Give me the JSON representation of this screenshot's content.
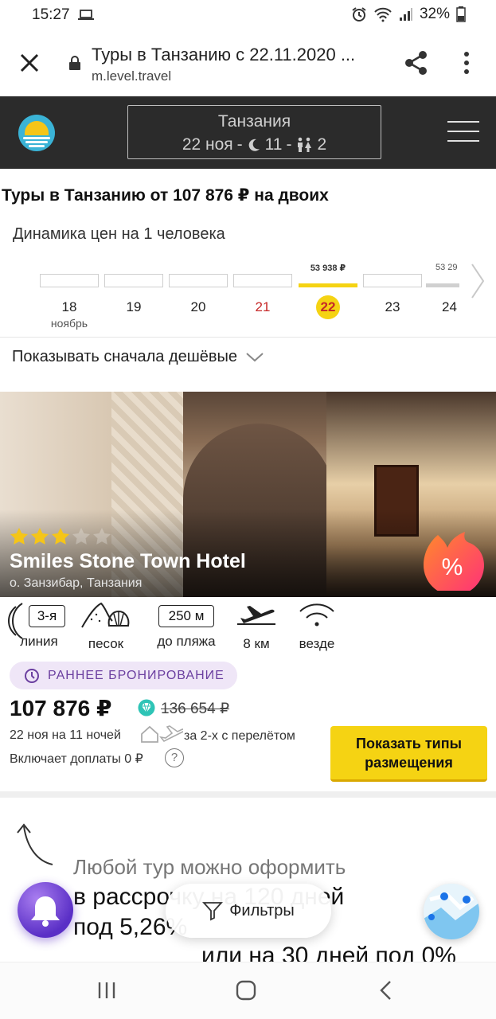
{
  "status_bar": {
    "time": "15:27",
    "battery": "32%"
  },
  "browser": {
    "title": "Туры в Танзанию с 22.11.2020 ...",
    "url": "m.level.travel"
  },
  "header": {
    "destination": "Танзания",
    "date": "22 ноя",
    "nights": "11",
    "tourists": "2",
    "separator": "-"
  },
  "page": {
    "heading": "Туры в Танзанию от 107 876 ₽ на двоих",
    "dynamics_title": "Динамика цен на 1 человека",
    "sort_label": "Показывать сначала дешёвые"
  },
  "calendar": {
    "month": "ноябрь",
    "days": [
      {
        "day": "18",
        "price": "",
        "weekend": false,
        "selected": false
      },
      {
        "day": "19",
        "price": "",
        "weekend": false,
        "selected": false
      },
      {
        "day": "20",
        "price": "",
        "weekend": false,
        "selected": false
      },
      {
        "day": "21",
        "price": "",
        "weekend": true,
        "selected": false
      },
      {
        "day": "22",
        "price": "53 938 ₽",
        "weekend": true,
        "selected": true
      },
      {
        "day": "23",
        "price": "",
        "weekend": false,
        "selected": false
      },
      {
        "day": "24",
        "price": "53 29",
        "weekend": false,
        "selected": false
      }
    ]
  },
  "hotel": {
    "stars": 3,
    "name": "Smiles Stone Town Hotel",
    "location": "о. Занзибар, Танзания",
    "discount_badge": "%",
    "features": {
      "line_value": "3-я",
      "line_label": "линия",
      "beach_label": "песок",
      "distance_value": "250 м",
      "distance_label": "до пляжа",
      "airport_label": "8 км",
      "wifi_label": "везде"
    },
    "early_booking": "РАННЕЕ БРОНИРОВАНИЕ",
    "price": "107 876 ₽",
    "old_price": "136 654 ₽",
    "dates_text": "22 ноя на 11 ночей",
    "with_flight": "за 2-х с перелётом",
    "extra_fees": "Включает доплаты 0 ₽",
    "help": "?",
    "show_button": "Показать типы размещения"
  },
  "promo": {
    "line1": "Любой тур можно оформить",
    "line2": "в рассрочку на 120 дней",
    "line3": "под 5,26%",
    "line4": "или на 30 дней под 0%"
  },
  "filters": {
    "label": "Фильтры"
  },
  "colors": {
    "accent_yellow": "#f5d313",
    "header_dark": "#2b2b2b",
    "early_booking_purple": "#6b3fa0",
    "weekend_red": "#c62828"
  }
}
